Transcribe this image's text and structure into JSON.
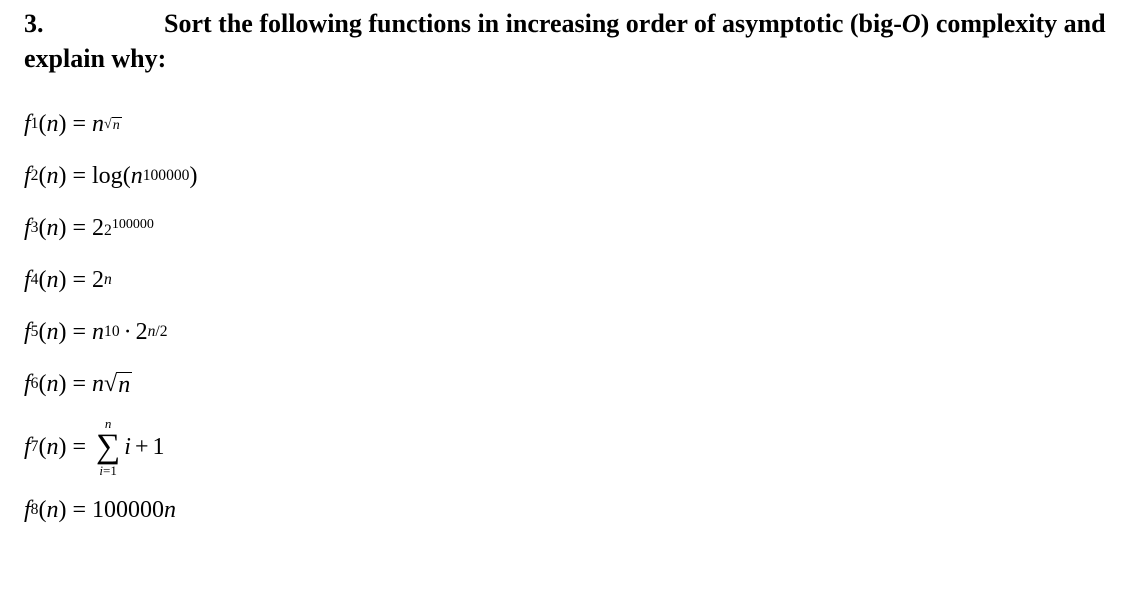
{
  "problem": {
    "number": "3.",
    "title_part1": "Sort the following functions in increasing order of asymptotic (big-",
    "title_italic": "O",
    "title_part2": ") complexity and explain why:"
  },
  "fns": {
    "f1": {
      "label": "f",
      "sub": "1",
      "arg": "n"
    },
    "f2": {
      "label": "f",
      "sub": "2",
      "arg": "n"
    },
    "f3": {
      "label": "f",
      "sub": "3",
      "arg": "n"
    },
    "f4": {
      "label": "f",
      "sub": "4",
      "arg": "n"
    },
    "f5": {
      "label": "f",
      "sub": "5",
      "arg": "n"
    },
    "f6": {
      "label": "f",
      "sub": "6",
      "arg": "n"
    },
    "f7": {
      "label": "f",
      "sub": "7",
      "arg": "n"
    },
    "f8": {
      "label": "f",
      "sub": "8",
      "arg": "n"
    }
  },
  "rhs": {
    "f1": {
      "base": "n",
      "exp_radicand": "n"
    },
    "f2": {
      "log": "log",
      "inner_base": "n",
      "inner_exp": "100000"
    },
    "f3": {
      "base": "2",
      "exp_base": "2",
      "exp_exp": "100000"
    },
    "f4": {
      "base": "2",
      "exp": "n"
    },
    "f5": {
      "b1": "n",
      "e1": "10",
      "b2": "2",
      "e2_top": "n",
      "e2_slash": "/",
      "e2_bot": "2"
    },
    "f6": {
      "a": "n",
      "radicand": "n"
    },
    "f7": {
      "sum_top": "n",
      "sum_bot_i": "i",
      "sum_bot_eq": "=",
      "sum_bot_1": "1",
      "term_i": "i",
      "plus": "+",
      "term_1": "1"
    },
    "f8": {
      "coef": "100000",
      "var": "n"
    }
  },
  "symbols": {
    "eq": "=",
    "lparen": "(",
    "rparen": ")",
    "surd": "√",
    "dot": "·",
    "sigma": "∑"
  }
}
